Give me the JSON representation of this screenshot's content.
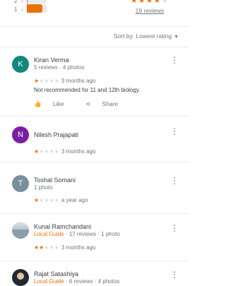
{
  "colors": {
    "accent": "#e8710a",
    "star_empty": "#dadce0"
  },
  "histogram": [
    {
      "label": "2",
      "fill": 0.05
    },
    {
      "label": "1",
      "fill": 0.8
    }
  ],
  "summary": {
    "rating_stars": 4,
    "reviews_link": "19 reviews"
  },
  "sort": {
    "label": "Sort by: Lowest rating",
    "chevron_icon": "chevron-down-icon"
  },
  "reviews": [
    {
      "initial": "K",
      "avatar_color": "#12877a",
      "name": "Kiran Verma",
      "meta": "5 reviews · 4 photos",
      "rating": 1,
      "time": "3 months ago",
      "text": "Not  recommended  for 11  and 12th biology.",
      "like_label": "Like",
      "share_label": "Share"
    },
    {
      "initial": "N",
      "avatar_color": "#7b1fa2",
      "name": "Nilesh Prajapati",
      "meta": "",
      "rating": 1,
      "time": "3 months ago"
    },
    {
      "initial": "T",
      "avatar_color": "#78909c",
      "name": "Toshal Somani",
      "meta": "1 photo",
      "rating": 1,
      "time": "a year ago"
    },
    {
      "initial": "",
      "avatar_color": "#9ab3c4",
      "name": "Kunal Ramchandani",
      "guide": "Local Guide",
      "meta": " · 17 reviews · 1 photo",
      "rating": 2,
      "time": "3 months ago"
    },
    {
      "initial": "",
      "avatar_color": "#263238",
      "name": "Rajat Satashiya",
      "guide": "Local Guide",
      "meta": " · 6 reviews · 4 photos",
      "rating": 1,
      "time": ""
    }
  ]
}
